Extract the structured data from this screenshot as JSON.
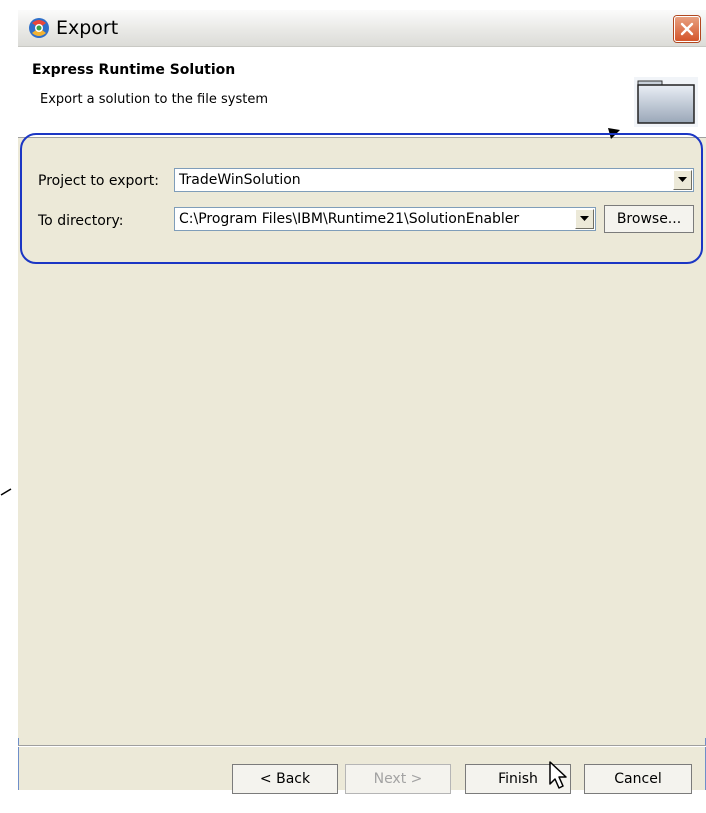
{
  "window": {
    "title": "Export"
  },
  "header": {
    "title": "Express Runtime Solution",
    "subtitle": "Export a solution to the file system"
  },
  "form": {
    "project_label": "Project to export:",
    "project_value": "TradeWinSolution",
    "directory_label": "To directory:",
    "directory_value": "C:\\Program Files\\IBM\\Runtime21\\SolutionEnabler",
    "browse_label": "Browse..."
  },
  "buttons": {
    "back": "< Back",
    "next": "Next >",
    "finish": "Finish",
    "cancel": "Cancel"
  },
  "colors": {
    "highlight": "#1b36c4",
    "dialog_bg": "#ece9d8",
    "close": "#d4552b"
  },
  "icons": {
    "title": "eclipse-app-icon",
    "close": "close-icon",
    "header": "folder-icon",
    "dropdown": "chevron-down-icon",
    "cursor": "mouse-pointer-icon"
  }
}
